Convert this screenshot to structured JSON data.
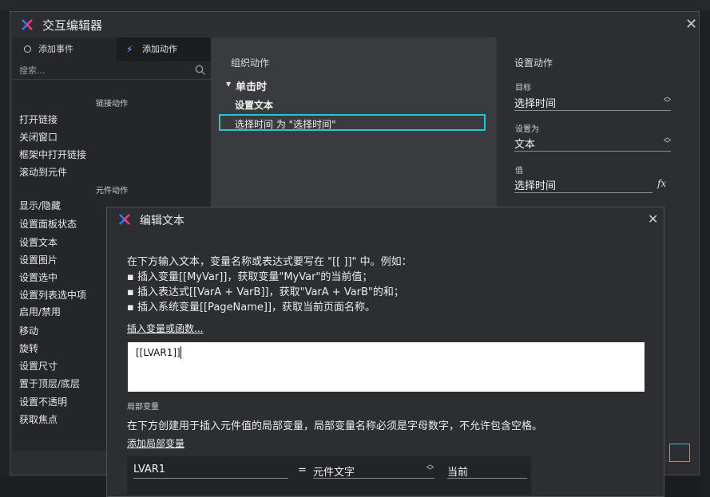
{
  "main_dialog": {
    "title": "交互编辑器"
  },
  "left_panel": {
    "tabs": [
      {
        "label": "添加事件",
        "icon": "radio-icon"
      },
      {
        "label": "添加动作",
        "icon": "lightning-icon"
      }
    ],
    "search_placeholder": "搜索...",
    "groups": [
      {
        "heading": "链接动作",
        "items": [
          "打开链接",
          "关闭窗口",
          "框架中打开链接",
          "滚动到元件"
        ]
      },
      {
        "heading": "元件动作",
        "items": [
          "显示/隐藏",
          "设置面板状态",
          "设置文本",
          "设置图片",
          "设置选中",
          "设置列表选中项",
          "启用/禁用",
          "移动",
          "旋转",
          "设置尺寸",
          "置于顶层/底层",
          "设置不透明",
          "获取焦点"
        ]
      }
    ]
  },
  "middle_panel": {
    "heading": "组织动作",
    "event_label": "单击时",
    "action_label": "设置文本",
    "action_detail": "选择时间 为 \"选择时间\""
  },
  "right_panel": {
    "heading": "设置动作",
    "target_label": "目标",
    "target_value": "选择时间",
    "set_to_label": "设置为",
    "set_to_value": "文本",
    "value_label": "值",
    "value_value": "选择时间",
    "fx_label": "fx"
  },
  "edit_dialog": {
    "title": "编辑文本",
    "intro_line": "在下方输入文本，变量名称或表达式要写在 \"[[ ]]\" 中。例如：",
    "examples": [
      "▪ 插入变量[[MyVar]]，获取变量\"MyVar\"的当前值；",
      "▪ 插入表达式[[VarA + VarB]]，获取\"VarA + VarB\"的和；",
      "▪ 插入系统变量[[PageName]]，获取当前页面名称。"
    ],
    "insert_link": "插入变量或函数...",
    "text_value": "[[LVAR1]]",
    "local_vars_heading": "局部变量",
    "local_vars_desc": "在下方创建用于插入元件值的局部变量，局部变量名称必须是字母数字，不允许包含空格。",
    "add_local_var_link": "添加局部变量",
    "var_row": {
      "name": "LVAR1",
      "equals": "=",
      "type": "元件文字",
      "target": "当前"
    }
  },
  "colors": {
    "accent_cyan": "#1fc8d6",
    "logo_blue": "#2f7bff",
    "logo_pink": "#ff3b8a"
  }
}
